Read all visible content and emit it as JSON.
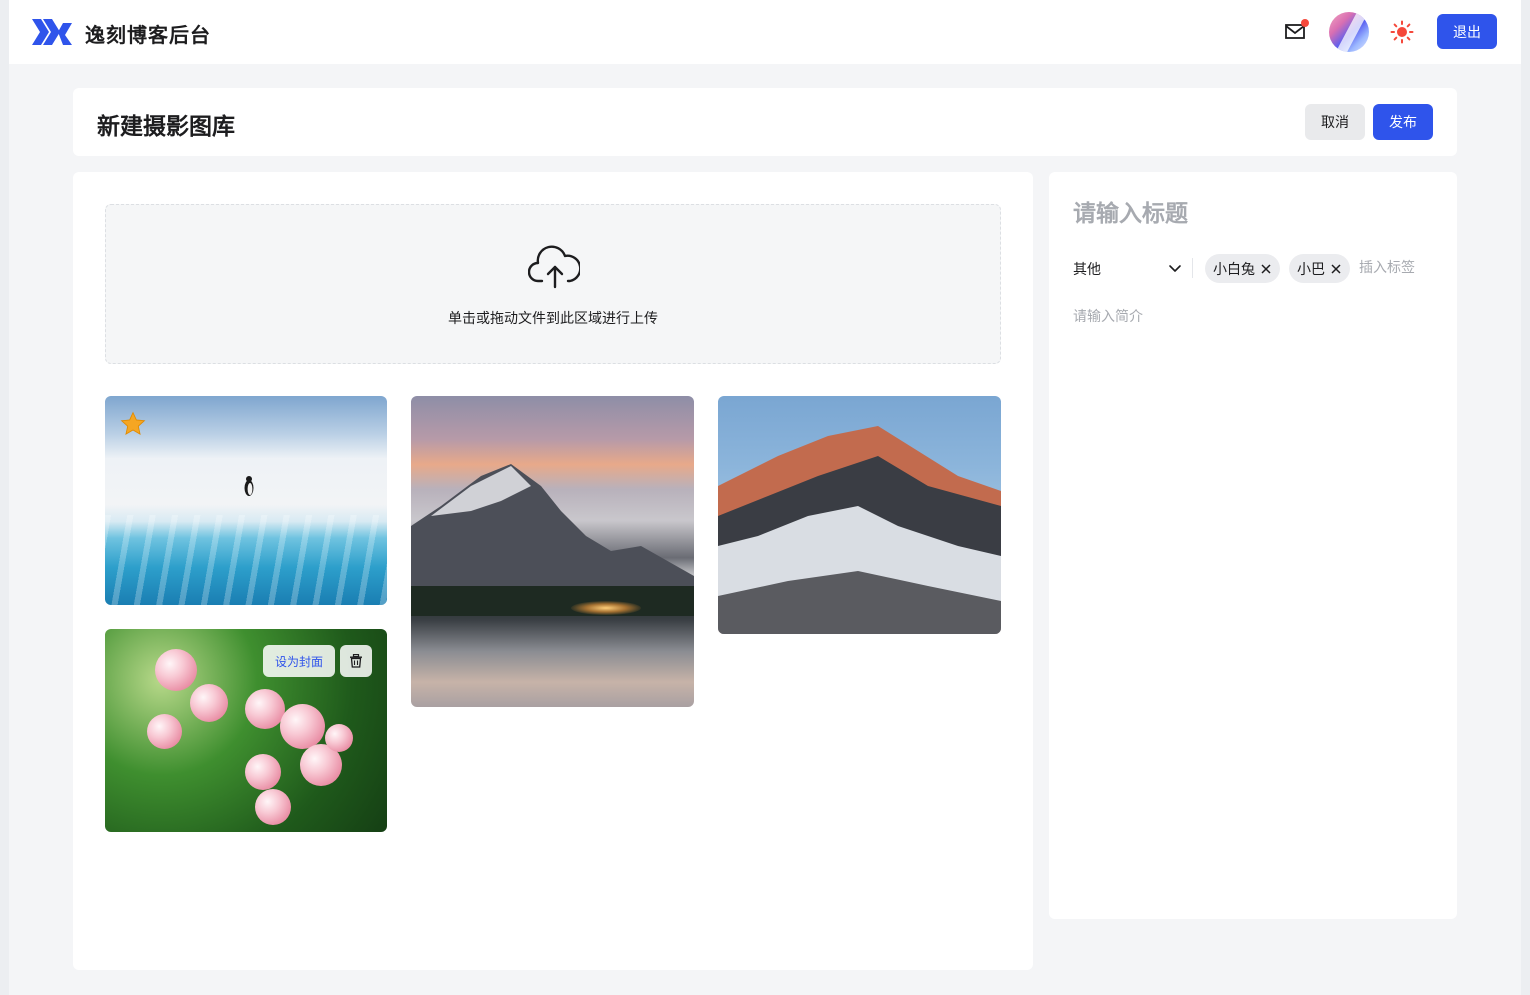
{
  "app": {
    "brand": "逸刻博客后台",
    "logout_label": "退出",
    "icons": [
      "logo-icon",
      "mail-icon",
      "avatar",
      "sun-icon"
    ],
    "accent_color": "#2f54eb",
    "notification_color": "#f5483b"
  },
  "page": {
    "title": "新建摄影图库",
    "cancel_label": "取消",
    "publish_label": "发布"
  },
  "upload": {
    "hint": "单击或拖动文件到此区域进行上传",
    "icon": "cloud-upload-icon"
  },
  "gallery": {
    "photos": [
      {
        "subject": "penguin on glacier",
        "is_cover": true
      },
      {
        "subject": "mountain lake at sunset"
      },
      {
        "subject": "snowy peak at sunrise"
      },
      {
        "subject": "pink grapes"
      }
    ],
    "set_cover_label": "设为封面",
    "delete_icon": "trash-icon",
    "cover_icon": "star-icon"
  },
  "form": {
    "title_placeholder": "请输入标题",
    "category_value": "其他",
    "tags": [
      "小白兔",
      "小巴"
    ],
    "tag_placeholder": "插入标签",
    "intro_placeholder": "请输入简介"
  }
}
